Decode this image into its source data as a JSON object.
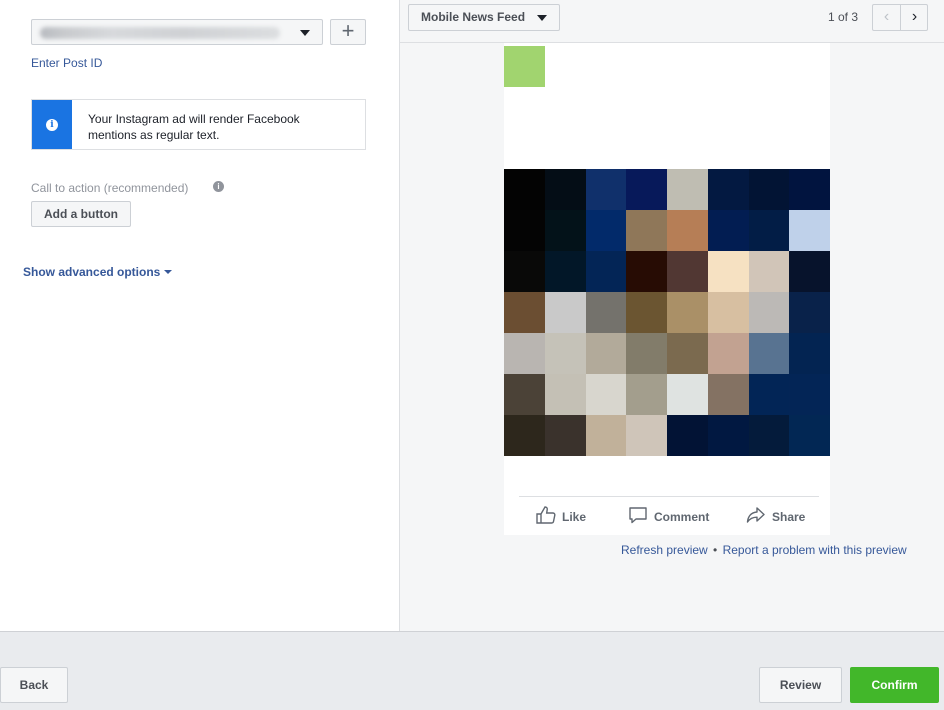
{
  "left": {
    "post_selector": {
      "value_obscured": true
    },
    "add_icon": "+",
    "enter_post_id": "Enter Post ID",
    "notice": {
      "icon": "info-icon",
      "text": "Your Instagram ad will render Facebook mentions as regular text."
    },
    "call_to_action": {
      "label": "Call to action (recommended)",
      "help_icon": "i",
      "button": "Add a button"
    },
    "advanced_options": "Show advanced options"
  },
  "preview": {
    "placement": "Mobile News Feed",
    "counter": "1 of 3",
    "prev_icon": "‹",
    "next_icon": "›",
    "actions": {
      "like": "Like",
      "comment": "Comment",
      "share": "Share"
    },
    "links": {
      "refresh": "Refresh preview",
      "separator": "•",
      "report": "Report a problem with this preview"
    },
    "image_pixels": [
      "#030303",
      "#040d16",
      "#10306b",
      "#07195a",
      "#bfbdb2",
      "#031941",
      "#021434",
      "#01143f",
      "#040404",
      "#031219",
      "#022a6a",
      "#8f7759",
      "#b67e56",
      "#021d52",
      "#021d46",
      "#bfd1ea",
      "#090908",
      "#021728",
      "#032556",
      "#270c04",
      "#513733",
      "#f6e1c2",
      "#d1c5b8",
      "#07132c",
      "#6b4e32",
      "#c9c9c9",
      "#74726c",
      "#6b5531",
      "#aa9067",
      "#d7bfa1",
      "#bcb9b6",
      "#09224a",
      "#b9b5b1",
      "#c5c2b8",
      "#b2aa9a",
      "#827c6a",
      "#7b6a4f",
      "#c2a291",
      "#587391",
      "#032452",
      "#4b4237",
      "#c4c0b5",
      "#d8d6ce",
      "#a39e8d",
      "#dfe3e1",
      "#847263",
      "#022556",
      "#032556",
      "#2d271c",
      "#3a322c",
      "#c1b19a",
      "#cfc5b9",
      "#021335",
      "#011841",
      "#041b3b",
      "#022754"
    ]
  },
  "footer": {
    "back": "Back",
    "review": "Review",
    "confirm": "Confirm"
  },
  "colors": {
    "link": "#365899",
    "confirm": "#42b72a",
    "info_bar": "#1a74e2",
    "avatar": "#a1d46f"
  }
}
